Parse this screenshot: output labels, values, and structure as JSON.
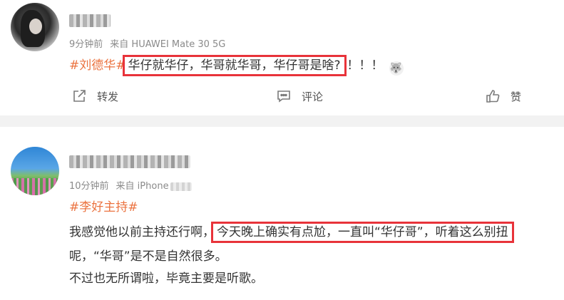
{
  "posts": [
    {
      "meta": {
        "time": "9分钟前",
        "source": "来自 HUAWEI Mate 30 5G"
      },
      "hashtag": "#刘德华#",
      "highlight": "华仔就华仔，华哥就华哥，华仔哥是啥?",
      "after": "！！！",
      "emoji_icon": "husky-face-icon",
      "actions": {
        "share": "转发",
        "comment": "评论",
        "like": "赞"
      }
    },
    {
      "meta": {
        "time": "10分钟前",
        "source": "来自 iPhone"
      },
      "hashtag": "#李好主持#",
      "line1_pre": "我感觉他以前主持还行啊，",
      "line1_highlight": "今天晚上确实有点尬，一直叫“华仔哥”，听着这么别扭",
      "line2": "呢，“华哥”是不是自然很多。",
      "line3": "不过也无所谓啦，毕竟主要是听歌。"
    }
  ],
  "colors": {
    "hashtag": "#eb7340",
    "highlight_box": "#e8333a",
    "divider": "#f2f2f2"
  }
}
